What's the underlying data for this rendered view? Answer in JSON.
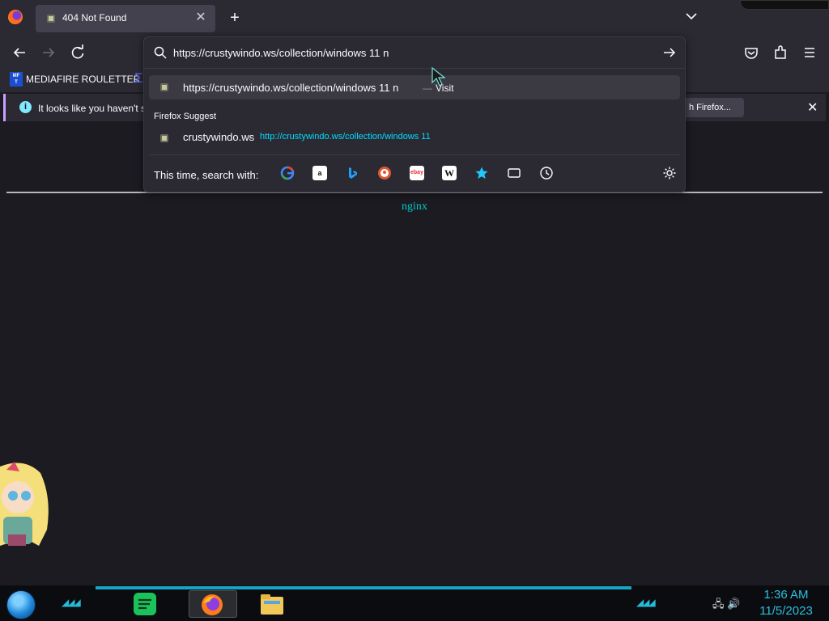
{
  "browser": {
    "tab": {
      "title": "404 Not Found"
    },
    "new_tab_label": "+",
    "tab_close_label": "✕"
  },
  "bookmarks": {
    "items": [
      {
        "label": "MEDIAFIRE ROULETTER",
        "icon_text": "MF\nT"
      }
    ]
  },
  "notification": {
    "text": "It looks like you haven't s",
    "button_label": "h Firefox...",
    "close_label": "✕"
  },
  "urlbar": {
    "value": "https://crustywindo.ws/collection/windows 11 n",
    "results": [
      {
        "title": "https://crustywindo.ws/collection/windows 11 n",
        "action": "Visit",
        "dash": "—"
      }
    ],
    "suggest_header": "Firefox Suggest",
    "suggestion": {
      "title": "crustywindo.ws",
      "dash": "—",
      "url": "http://crustywindo.ws/collection/windows 11"
    },
    "search_with_label": "This time, search with:",
    "engines": [
      "google-icon",
      "amazon-icon",
      "bing-icon",
      "duckduckgo-icon",
      "ebay-icon",
      "wikipedia-icon",
      "bookmarks-icon",
      "tabs-icon",
      "history-icon"
    ]
  },
  "page": {
    "server": "nginx"
  },
  "taskbar": {
    "apps": [
      "notes-app-icon",
      "firefox-icon",
      "file-explorer-icon"
    ],
    "clock_time": "1:36 AM",
    "clock_date": "11/5/2023"
  },
  "colors": {
    "accent_blue": "#00ddff",
    "nginx_cyan": "#00c8c8",
    "clock_cyan": "#2ac0e0"
  }
}
